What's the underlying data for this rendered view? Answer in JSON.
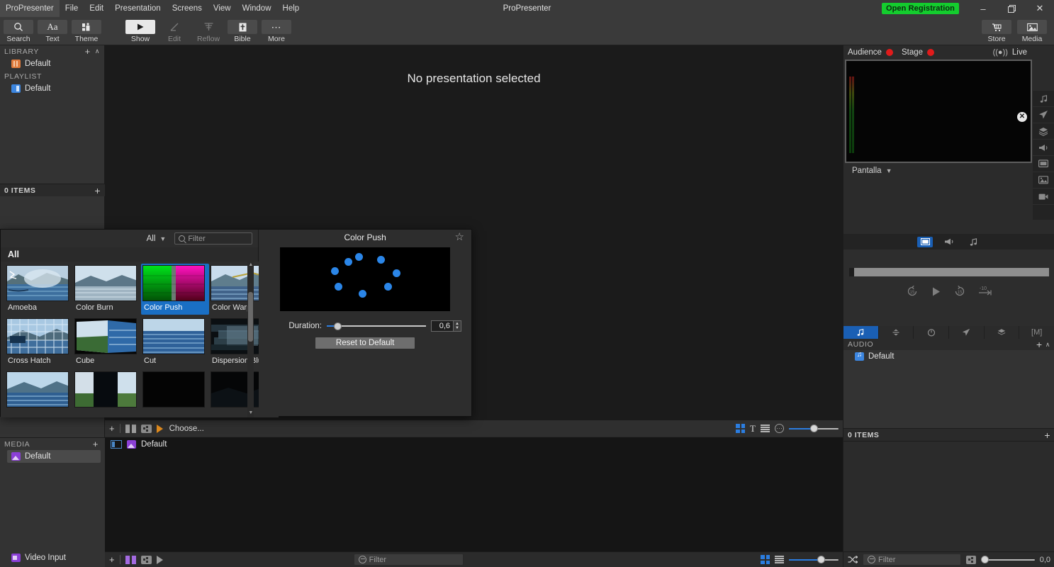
{
  "menubar": {
    "items": [
      "ProPresenter",
      "File",
      "Edit",
      "Presentation",
      "Screens",
      "View",
      "Window",
      "Help"
    ],
    "window_title": "ProPresenter",
    "registration_badge": "Open Registration",
    "minimize": "–",
    "maximize": "❐",
    "close": "✕"
  },
  "toolbar": {
    "left": [
      {
        "label": "Search",
        "icon": "search-icon",
        "state": "normal"
      },
      {
        "label": "Text",
        "icon": "text-icon",
        "state": "normal"
      },
      {
        "label": "Theme",
        "icon": "theme-icon",
        "state": "normal"
      }
    ],
    "center": [
      {
        "label": "Show",
        "icon": "play-icon",
        "state": "active"
      },
      {
        "label": "Edit",
        "icon": "pencil-icon",
        "state": "dim"
      },
      {
        "label": "Reflow",
        "icon": "reflow-icon",
        "state": "dim"
      },
      {
        "label": "Bible",
        "icon": "bible-icon",
        "state": "normal"
      },
      {
        "label": "More",
        "icon": "ellipsis-icon",
        "state": "normal"
      }
    ],
    "right": [
      {
        "label": "Store",
        "icon": "cart-icon"
      },
      {
        "label": "Media",
        "icon": "media-icon"
      }
    ]
  },
  "sidebar": {
    "library": {
      "title": "LIBRARY",
      "items": [
        {
          "label": "Default",
          "icon": "library-icon"
        }
      ]
    },
    "playlist": {
      "title": "PLAYLIST",
      "items": [
        {
          "label": "Default",
          "icon": "playlist-icon"
        }
      ]
    },
    "items_count": "0 ITEMS",
    "add": "+",
    "collapse": "∧",
    "filter_placeholder": "Filter",
    "media": {
      "title": "MEDIA",
      "items": [
        {
          "label": "Default",
          "icon": "media-bin-icon"
        }
      ],
      "video_input": "Video Input"
    }
  },
  "main": {
    "empty_message": "No presentation selected"
  },
  "slide_toolbar": {
    "add": "+",
    "arrangement_icon": "columns-icon",
    "group_icon": "group-icon",
    "transition_icon": "transition-icon",
    "choose_label": "Choose...",
    "view_grid_icon": "grid-view-icon",
    "view_text_icon": "text-view-icon",
    "view_list_icon": "list-view-icon",
    "options_icon": "options-icon",
    "zoom_value": 48
  },
  "slide_list": {
    "rows": [
      {
        "label": "Default",
        "icon": "slide-thumb-icon"
      }
    ]
  },
  "bottom_toolbar": {
    "add": "+",
    "columns_icon": "columns-icon",
    "group_icon": "group-icon",
    "transition_icon": "transition-icon",
    "filter_placeholder": "Filter",
    "grid_icon": "grid-view-icon",
    "list_icon": "list-view-icon",
    "zoom_value": 62
  },
  "transition_popover": {
    "scope_label": "All",
    "filter_placeholder": "Filter",
    "category_header": "All",
    "selected": "Color Push",
    "items": [
      {
        "label": "Amoeba",
        "thumb": "landscape-dissolve"
      },
      {
        "label": "Color Burn",
        "thumb": "landscape-burn"
      },
      {
        "label": "Color Push",
        "thumb": "color-bars"
      },
      {
        "label": "Color Warp",
        "thumb": "landscape-warp"
      },
      {
        "label": "Cross Hatch",
        "thumb": "landscape-hatch"
      },
      {
        "label": "Cube",
        "thumb": "landscape-cube"
      },
      {
        "label": "Cut",
        "thumb": "water-plain"
      },
      {
        "label": "Dispersion Blur",
        "thumb": "landscape-blur"
      },
      {
        "label": "",
        "thumb": "landscape-rainbow"
      },
      {
        "label": "",
        "thumb": "landscape-split"
      },
      {
        "label": "",
        "thumb": "black"
      },
      {
        "label": "",
        "thumb": "dark-hills"
      }
    ],
    "detail": {
      "title": "Color Push",
      "favorite_icon": "star-icon",
      "duration_label": "Duration:",
      "duration_value": "0,6",
      "reset_label": "Reset to Default",
      "preview_icon": "loading-spinner"
    }
  },
  "right_panel": {
    "audience_label": "Audience",
    "stage_label": "Stage",
    "live_label": "Live",
    "live_icon": "broadcast-icon",
    "screen_name": "Pantalla",
    "close_icon": "close-circle-icon",
    "rail_icons": [
      "music-icon",
      "send-icon",
      "layers-icon",
      "megaphone-icon",
      "screen-icon",
      "image-icon",
      "video-icon"
    ],
    "segments": [
      {
        "icon": "screen-icon",
        "active": true
      },
      {
        "icon": "megaphone-icon",
        "active": false
      },
      {
        "icon": "music-icon",
        "active": false
      }
    ],
    "transport": {
      "back15_icon": "rewind-15-icon",
      "play_icon": "play-icon",
      "fwd15_icon": "forward-15-icon",
      "skip_icon": "skip-minus-10-icon",
      "skip_label": "-10"
    },
    "tabs": [
      {
        "icon": "music-icon",
        "active": true
      },
      {
        "icon": "props-icon",
        "active": false
      },
      {
        "icon": "timer-icon",
        "active": false
      },
      {
        "icon": "send-icon",
        "active": false
      },
      {
        "icon": "layers-icon",
        "active": false
      },
      {
        "icon": "macro-icon",
        "label": "[M]",
        "active": false
      }
    ],
    "audio": {
      "title": "AUDIO",
      "add": "+",
      "collapse": "∧",
      "items": [
        {
          "label": "Default",
          "icon": "audio-bin-icon"
        }
      ]
    },
    "items_count": "0 ITEMS",
    "add": "+",
    "bottom": {
      "shuffle_icon": "shuffle-icon",
      "filter_placeholder": "Filter",
      "group_icon": "group-icon",
      "volume_value": "0,0"
    }
  },
  "colors": {
    "accent_blue": "#1a6fc4",
    "slider_blue": "#2b7de0",
    "registration_green": "#14cc2e",
    "record_red": "#e01b1b",
    "library_orange": "#e07b3c",
    "playlist_blue": "#3c86e0",
    "media_purple": "#8b3fd6",
    "transition_orange": "#e08b1e"
  }
}
